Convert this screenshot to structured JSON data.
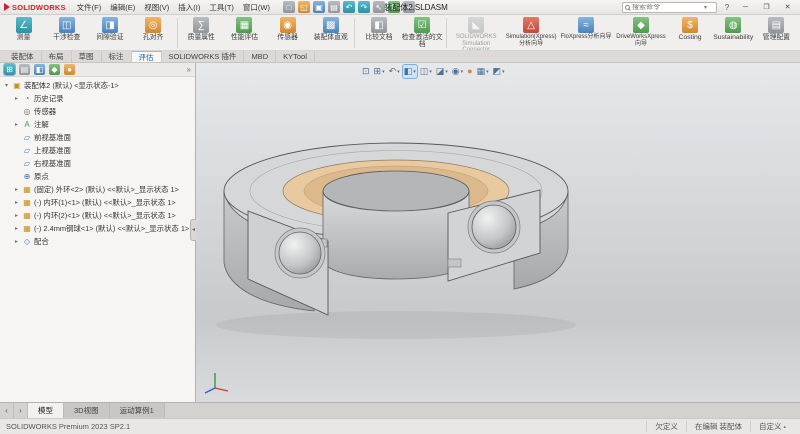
{
  "colors": {
    "brand_red": "#cf2030",
    "accent_blue": "#0b64a8",
    "section_face_tan": "#e9c9a0",
    "model_gray": "#d6d7d8"
  },
  "titlebar": {
    "logo_text": "SOLIDWORKS",
    "menus": [
      "文件(F)",
      "编辑(E)",
      "视图(V)",
      "插入(I)",
      "工具(T)",
      "窗口(W)"
    ],
    "qat": [
      {
        "name": "new-document-icon",
        "glyph": "□"
      },
      {
        "name": "open-icon",
        "glyph": "◱"
      },
      {
        "name": "save-icon",
        "glyph": "▣"
      },
      {
        "name": "print-icon",
        "glyph": "▤"
      },
      {
        "name": "undo-icon",
        "glyph": "↶"
      },
      {
        "name": "redo-icon",
        "glyph": "↷"
      },
      {
        "name": "select-icon",
        "glyph": "↖"
      },
      {
        "name": "rebuild-icon",
        "glyph": "↻"
      },
      {
        "name": "options-icon",
        "glyph": "≡"
      }
    ],
    "document_title": "装配体2.SLDASM",
    "search_placeholder": "搜索命令",
    "search_caret": "▾",
    "help_label": "?",
    "window": {
      "minimize": "─",
      "maximize": "❐",
      "close": "✕"
    }
  },
  "ribbon": {
    "items": [
      {
        "label": "测量",
        "glyph": "∠"
      },
      {
        "label": "干涉检查",
        "glyph": "◫"
      },
      {
        "label": "间隙验证",
        "glyph": "◨"
      },
      {
        "label": "孔对齐",
        "glyph": "◎"
      },
      {
        "label": "质量属性",
        "glyph": "∑"
      },
      {
        "label": "性能评估",
        "glyph": "▦"
      },
      {
        "label": "传感器",
        "glyph": "◉"
      },
      {
        "label": "装配体直观",
        "glyph": "▩"
      },
      {
        "label": "比较文档",
        "glyph": "◧"
      },
      {
        "label": "检查激活的文档",
        "glyph": "☑"
      },
      {
        "label": "SOLIDWORKS Simulation Connector",
        "glyph": "◣"
      },
      {
        "label": "Simulation(Xpress)分析向导",
        "glyph": "△"
      },
      {
        "label": "FloXpress分析向导",
        "glyph": "≈"
      },
      {
        "label": "DriveWorksXpress向导",
        "glyph": "◆"
      },
      {
        "label": "Costing",
        "glyph": "$"
      },
      {
        "label": "Sustainability",
        "glyph": "◍"
      },
      {
        "label": "管理配置",
        "glyph": "▤"
      }
    ]
  },
  "command_tabs": {
    "items": [
      "装配体",
      "布局",
      "草图",
      "标注",
      "评估",
      "SOLIDWORKS 插件",
      "MBD",
      "KYTool"
    ]
  },
  "panel": {
    "tabs": [
      {
        "name": "featuremanager-tree-tab",
        "glyph": "⊞"
      },
      {
        "name": "propertymanager-tab",
        "glyph": "▤"
      },
      {
        "name": "configurationmanager-tab",
        "glyph": "◧"
      },
      {
        "name": "dimxpertmanager-tab",
        "glyph": "◆"
      },
      {
        "name": "displaymanager-tab",
        "glyph": "●"
      }
    ],
    "overflow_glyph": "»",
    "collapse_glyph": "◂"
  },
  "tree": {
    "items": [
      {
        "label": "装配体2 (默认) <显示状态-1>",
        "caret": "▾"
      },
      {
        "label": "历史记录",
        "caret": "▸"
      },
      {
        "label": "传感器",
        "caret": ""
      },
      {
        "label": "注解",
        "caret": "▸"
      },
      {
        "label": "前视基准面",
        "caret": ""
      },
      {
        "label": "上视基准面",
        "caret": ""
      },
      {
        "label": "右视基准面",
        "caret": ""
      },
      {
        "label": "原点",
        "caret": ""
      },
      {
        "label": "(固定) 外环<2> (默认) <<默认>_显示状态 1>",
        "caret": "▸"
      },
      {
        "label": "(-) 内环(1)<1> (默认) <<默认>_显示状态 1>",
        "caret": "▸"
      },
      {
        "label": "(-) 内环(2)<1> (默认) <<默认>_显示状态 1>",
        "caret": "▸"
      },
      {
        "label": "(-) 2.4mm钢球<1> (默认) <<默认>_显示状态 1>",
        "caret": "▸"
      },
      {
        "label": "配合",
        "caret": "▸"
      }
    ]
  },
  "headsup": {
    "caret_glyph": "▾",
    "items": [
      {
        "name": "zoom-fit-icon",
        "glyph": "⊡"
      },
      {
        "name": "zoom-area-icon",
        "glyph": "⊞"
      },
      {
        "name": "previous-view-icon",
        "glyph": "↶"
      },
      {
        "name": "section-view-icon",
        "glyph": "◧"
      },
      {
        "name": "view-orientation-icon",
        "glyph": "◫"
      },
      {
        "name": "display-style-icon",
        "glyph": "◪"
      },
      {
        "name": "hide-show-items-icon",
        "glyph": "◉"
      },
      {
        "name": "edit-appearance-icon",
        "glyph": "●"
      },
      {
        "name": "apply-scene-icon",
        "glyph": "▦"
      },
      {
        "name": "view-settings-icon",
        "glyph": "◩"
      }
    ]
  },
  "bottom_tabs": {
    "nav_left": "‹",
    "nav_right": "›",
    "items": [
      "模型",
      "3D视图",
      "运动算例1"
    ]
  },
  "statusbar": {
    "app_version": "SOLIDWORKS Premium 2023 SP2.1",
    "definition_status": "欠定义",
    "editing_status": "在编辑 装配体",
    "units": "自定义",
    "units_caret": "▴"
  }
}
